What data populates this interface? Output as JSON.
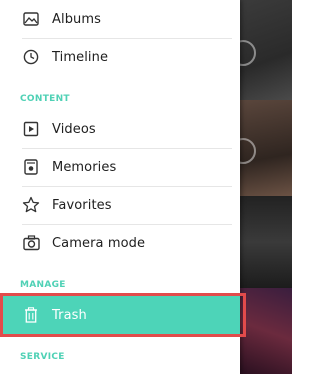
{
  "drawer": {
    "items_top": [
      {
        "label": "Albums",
        "icon": "albums-icon"
      },
      {
        "label": "Timeline",
        "icon": "clock-icon"
      }
    ],
    "sections": {
      "content": "CONTENT",
      "manage": "MANAGE",
      "service": "SERVICE"
    },
    "content_items": [
      {
        "label": "Videos",
        "icon": "video-icon"
      },
      {
        "label": "Memories",
        "icon": "memories-icon"
      },
      {
        "label": "Favorites",
        "icon": "star-icon"
      },
      {
        "label": "Camera mode",
        "icon": "camera-icon"
      }
    ],
    "manage_items": [
      {
        "label": "Trash",
        "icon": "trash-icon",
        "active": true
      }
    ]
  },
  "colors": {
    "accent": "#4dd4b8",
    "section_header": "#4fd1b5",
    "highlight_border": "#e24b4b"
  }
}
